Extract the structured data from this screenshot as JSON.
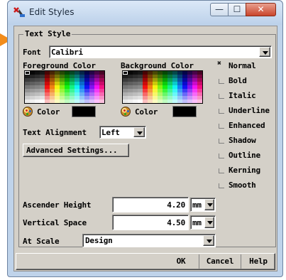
{
  "window": {
    "title": "Edit Styles",
    "min_glyph": "—",
    "max_glyph": "☐",
    "close_glyph": "✕"
  },
  "group": {
    "title": "Text Style"
  },
  "font": {
    "label": "Font",
    "value": "Calibri"
  },
  "foreground": {
    "label": "Foreground Color",
    "button_label": "Color",
    "current_color": "#000000"
  },
  "background": {
    "label": "Background Color",
    "button_label": "Color",
    "current_color": "#000000"
  },
  "alignment": {
    "label": "Text Alignment",
    "value": "Left"
  },
  "advanced_button": "Advanced Settings...",
  "styles": [
    {
      "label": "Normal",
      "checked": true
    },
    {
      "label": "Bold",
      "checked": false
    },
    {
      "label": "Italic",
      "checked": false
    },
    {
      "label": "Underline",
      "checked": false
    },
    {
      "label": "Enhanced",
      "checked": false
    },
    {
      "label": "Shadow",
      "checked": false
    },
    {
      "label": "Outline",
      "checked": false
    },
    {
      "label": "Kerning",
      "checked": false
    },
    {
      "label": "Smooth",
      "checked": false
    }
  ],
  "ascender_height": {
    "label": "Ascender Height",
    "value": "4.20",
    "unit": "mm"
  },
  "vertical_space": {
    "label": "Vertical Space",
    "value": "4.50",
    "unit": "mm"
  },
  "at_scale": {
    "label": "At Scale",
    "value": "Design"
  },
  "buttons": {
    "ok": "OK",
    "cancel": "Cancel",
    "help": "Help"
  },
  "colors": {
    "accent_pointer": "#f28c1a",
    "dialog_bg": "#d4d0c8"
  }
}
